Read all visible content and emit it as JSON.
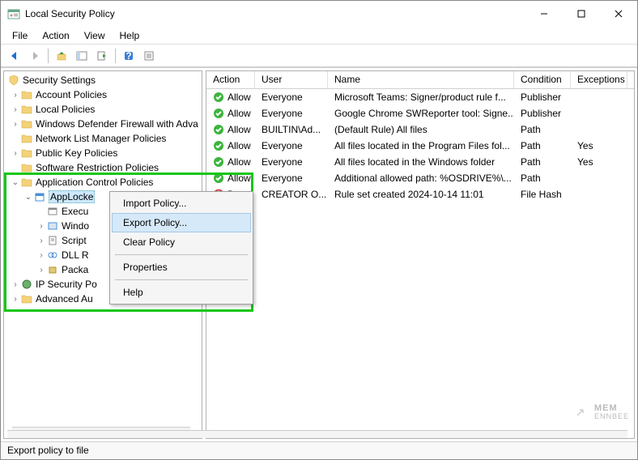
{
  "title": "Local Security Policy",
  "menubar": [
    "File",
    "Action",
    "View",
    "Help"
  ],
  "statusbar": "Export policy to file",
  "tree": {
    "root": "Security Settings",
    "items": [
      "Account Policies",
      "Local Policies",
      "Windows Defender Firewall with Adva",
      "Network List Manager Policies",
      "Public Key Policies",
      "Software Restriction Policies",
      "Application Control Policies",
      "IP Security Po",
      "Advanced Au"
    ],
    "applocker": {
      "label": "AppLocke",
      "children": [
        "Execu",
        "Windo",
        "Script",
        "DLL R",
        "Packa"
      ]
    }
  },
  "columns": [
    "Action",
    "User",
    "Name",
    "Condition",
    "Exceptions"
  ],
  "rows": [
    {
      "action": "Allow",
      "user": "Everyone",
      "name": "Microsoft Teams: Signer/product rule f...",
      "cond": "Publisher",
      "exc": ""
    },
    {
      "action": "Allow",
      "user": "Everyone",
      "name": "Google Chrome SWReporter tool: Signe...",
      "cond": "Publisher",
      "exc": ""
    },
    {
      "action": "Allow",
      "user": "BUILTIN\\Ad...",
      "name": "(Default Rule) All files",
      "cond": "Path",
      "exc": ""
    },
    {
      "action": "Allow",
      "user": "Everyone",
      "name": "All files located in the Program Files fol...",
      "cond": "Path",
      "exc": "Yes"
    },
    {
      "action": "Allow",
      "user": "Everyone",
      "name": "All files located in the Windows folder",
      "cond": "Path",
      "exc": "Yes"
    },
    {
      "action": "Allow",
      "user": "Everyone",
      "name": "Additional allowed path: %OSDRIVE%\\...",
      "cond": "Path",
      "exc": ""
    },
    {
      "action": "Deny",
      "user": "CREATOR O...",
      "name": "Rule set created 2024-10-14 11:01",
      "cond": "File Hash",
      "exc": ""
    }
  ],
  "context": {
    "items": [
      "Import Policy...",
      "Export Policy...",
      "Clear Policy",
      "Properties",
      "Help"
    ],
    "hover_index": 1
  },
  "watermark": "MEM\nENNBEE"
}
